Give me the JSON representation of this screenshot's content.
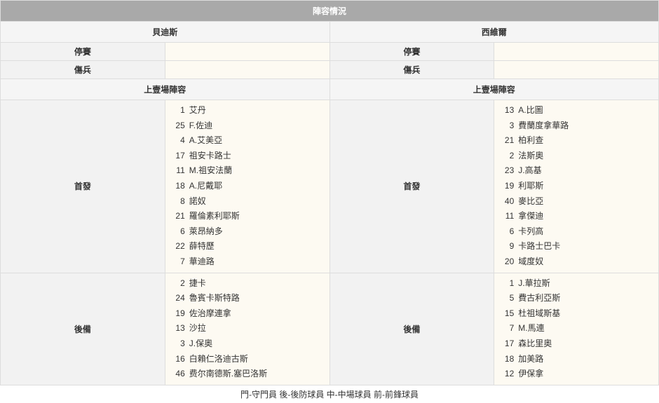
{
  "title": "陣容情況",
  "teams": {
    "home": "貝迪斯",
    "away": "西維爾"
  },
  "labels": {
    "suspended": "停賽",
    "injured": "傷兵",
    "last_lineup": "上壹場陣容",
    "starters": "首發",
    "subs": "後備"
  },
  "home": {
    "suspended": "",
    "injured": "",
    "starters": [
      {
        "num": "1",
        "name": "艾丹"
      },
      {
        "num": "25",
        "name": "F.佐迪"
      },
      {
        "num": "4",
        "name": "A.艾美亞"
      },
      {
        "num": "17",
        "name": "祖安卡路士"
      },
      {
        "num": "11",
        "name": "M.祖安法蘭"
      },
      {
        "num": "18",
        "name": "A.尼戴耶"
      },
      {
        "num": "8",
        "name": "諾奴"
      },
      {
        "num": "21",
        "name": "羅倫素利耶斯"
      },
      {
        "num": "6",
        "name": "萊昂納多"
      },
      {
        "num": "22",
        "name": "薛特歷"
      },
      {
        "num": "7",
        "name": "華迪路"
      }
    ],
    "subs": [
      {
        "num": "2",
        "name": "捷卡"
      },
      {
        "num": "24",
        "name": "魯賓卡斯特路"
      },
      {
        "num": "19",
        "name": "佐治摩連拿"
      },
      {
        "num": "13",
        "name": "沙拉"
      },
      {
        "num": "3",
        "name": "J.保奧"
      },
      {
        "num": "16",
        "name": "白賴仁洛迪古斯"
      },
      {
        "num": "46",
        "name": "费尔南德斯.塞巴洛斯"
      }
    ]
  },
  "away": {
    "suspended": "",
    "injured": "",
    "starters": [
      {
        "num": "13",
        "name": "A.比圖"
      },
      {
        "num": "3",
        "name": "費蘭度拿華路"
      },
      {
        "num": "21",
        "name": "柏利查"
      },
      {
        "num": "2",
        "name": "法斯奧"
      },
      {
        "num": "23",
        "name": "J.高基"
      },
      {
        "num": "19",
        "name": "利耶斯"
      },
      {
        "num": "40",
        "name": "麥比亞"
      },
      {
        "num": "11",
        "name": "拿傑迪"
      },
      {
        "num": "6",
        "name": "卡列高"
      },
      {
        "num": "9",
        "name": "卡路士巴卡"
      },
      {
        "num": "20",
        "name": "域度奴"
      }
    ],
    "subs": [
      {
        "num": "1",
        "name": "J.華拉斯"
      },
      {
        "num": "5",
        "name": "費古利亞斯"
      },
      {
        "num": "15",
        "name": "杜祖域斯基"
      },
      {
        "num": "7",
        "name": "M.馬連"
      },
      {
        "num": "17",
        "name": "森比里奧"
      },
      {
        "num": "18",
        "name": "加美路"
      },
      {
        "num": "12",
        "name": "伊保拿"
      }
    ]
  },
  "legend": "門-守門員 後-後防球員 中-中場球員 前-前鋒球員"
}
